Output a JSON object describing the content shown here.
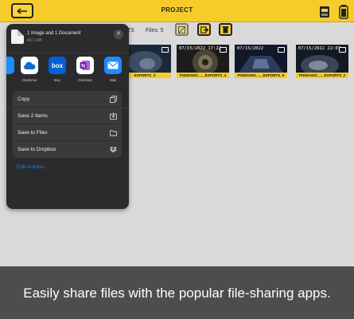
{
  "topbar": {
    "title": "PROJECT"
  },
  "toolbar": {
    "cut_label": "TS",
    "files_count": "Files: 5"
  },
  "thumbnails": [
    {
      "date": "",
      "label": "EXPORTS_3"
    },
    {
      "date": "07/15/2022 17:22",
      "label": "PODKANO_..._EXPORTS_4"
    },
    {
      "date": "07/15/2022",
      "label": "PODKANO_..._EXPORTS_5"
    },
    {
      "date": "07/15/2022 22:07",
      "label": "PODKANO_..._EXPORTS_2"
    }
  ],
  "share_sheet": {
    "title": "1 Image and 1 Document",
    "subtitle": "48.1 MB",
    "apps": [
      {
        "label": "OneDrive",
        "icon": "onedrive-icon",
        "color": "#ffffff"
      },
      {
        "label": "Box",
        "icon": "box-icon",
        "color": "#0061d5"
      },
      {
        "label": "OneNote",
        "icon": "onenote-icon",
        "color": "#ffffff"
      },
      {
        "label": "Mail",
        "icon": "mail-icon",
        "color": "#1e8bff"
      }
    ],
    "actions": [
      {
        "label": "Copy",
        "icon": "copy-icon"
      },
      {
        "label": "Save 2 Items",
        "icon": "save-items-icon"
      },
      {
        "label": "Save to Files",
        "icon": "folder-icon"
      },
      {
        "label": "Save to Dropbox",
        "icon": "dropbox-icon"
      }
    ],
    "edit_actions": "Edit Actions..."
  },
  "caption": "Easily share files with the popular file-sharing apps.",
  "colors": {
    "accent": "#f5cc2a",
    "sheet_bg": "#2b2b2d",
    "link": "#0a84ff"
  }
}
